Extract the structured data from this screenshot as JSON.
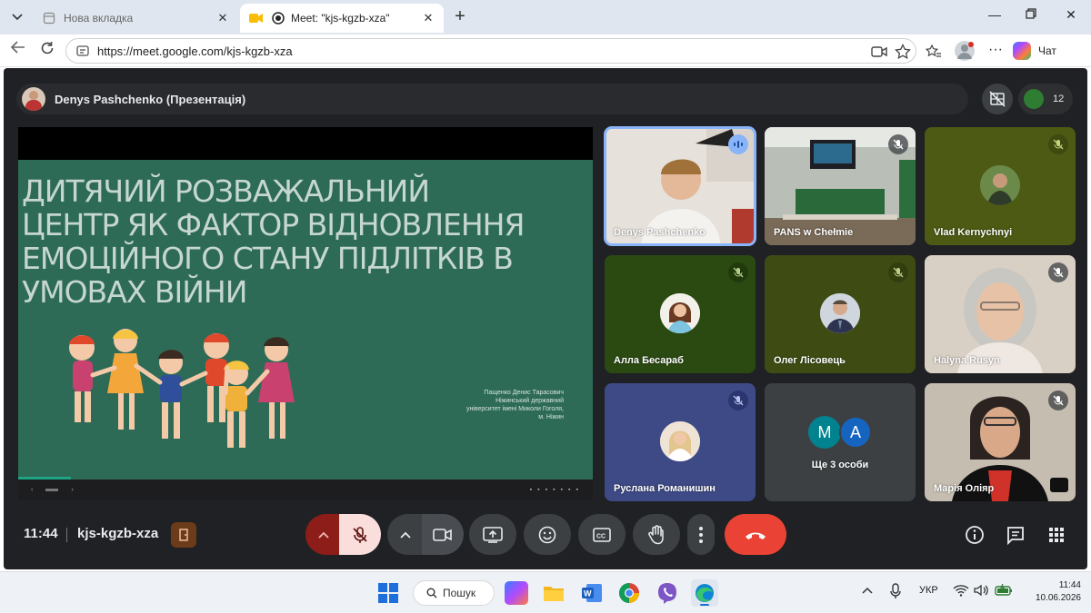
{
  "browser": {
    "tabs": [
      {
        "title": "Нова вкладка",
        "active": false
      },
      {
        "title": "Meet: \"kjs-kgzb-xza\"",
        "active": true
      }
    ],
    "url": "https://meet.google.com/kjs-kgzb-xza",
    "chat_label": "Чат"
  },
  "meet": {
    "presenter_label": "Denys Pashchenko (Презентація)",
    "participant_count": "12",
    "time": "11:44",
    "meeting_code": "kjs-kgzb-xza",
    "slide": {
      "title_lines": [
        "Дитячий розважальний",
        "центр як фактор відновлення",
        "емоційного стану підлітків в",
        "умовах війни"
      ],
      "author_lines": [
        "Пащенко Денис Тарасович",
        "Ніжинський державний",
        "університет імені Миколи Гоголя,",
        "м. Ніжин"
      ]
    },
    "tiles": [
      {
        "name": "Denys Pashchenko",
        "state": "speaking",
        "bg": "#e5e0d9"
      },
      {
        "name": "PANS w Chełmie",
        "state": "muted",
        "bg": "#6e7a6c"
      },
      {
        "name": "Vlad Kernychnyi",
        "state": "muted",
        "bg": "#4d5a14"
      },
      {
        "name": "Алла Бесараб",
        "state": "muted",
        "bg": "#2b4a12"
      },
      {
        "name": "Олег Лісовець",
        "state": "muted",
        "bg": "#3e4c14"
      },
      {
        "name": "Halyna Rusyn",
        "state": "muted",
        "bg": "#d8cfc4"
      },
      {
        "name": "Руслана Романишин",
        "state": "muted",
        "bg": "#3e4a86"
      },
      {
        "name": "Ще 3 особи",
        "state": "others",
        "bg": "#3c4043",
        "initials": [
          "M",
          "A"
        ]
      },
      {
        "name": "Марія Оліяр",
        "state": "muted",
        "bg": "#c7bfb4"
      }
    ],
    "colors": {
      "accent": "#8ab4f8",
      "hangup": "#ea4335",
      "teal_avatar": "#00838f",
      "blue_avatar": "#1565c0"
    }
  },
  "taskbar": {
    "search_label": "Пошук",
    "language": "УКР",
    "clock_time": "11:44",
    "clock_date": "10.06.2026"
  }
}
